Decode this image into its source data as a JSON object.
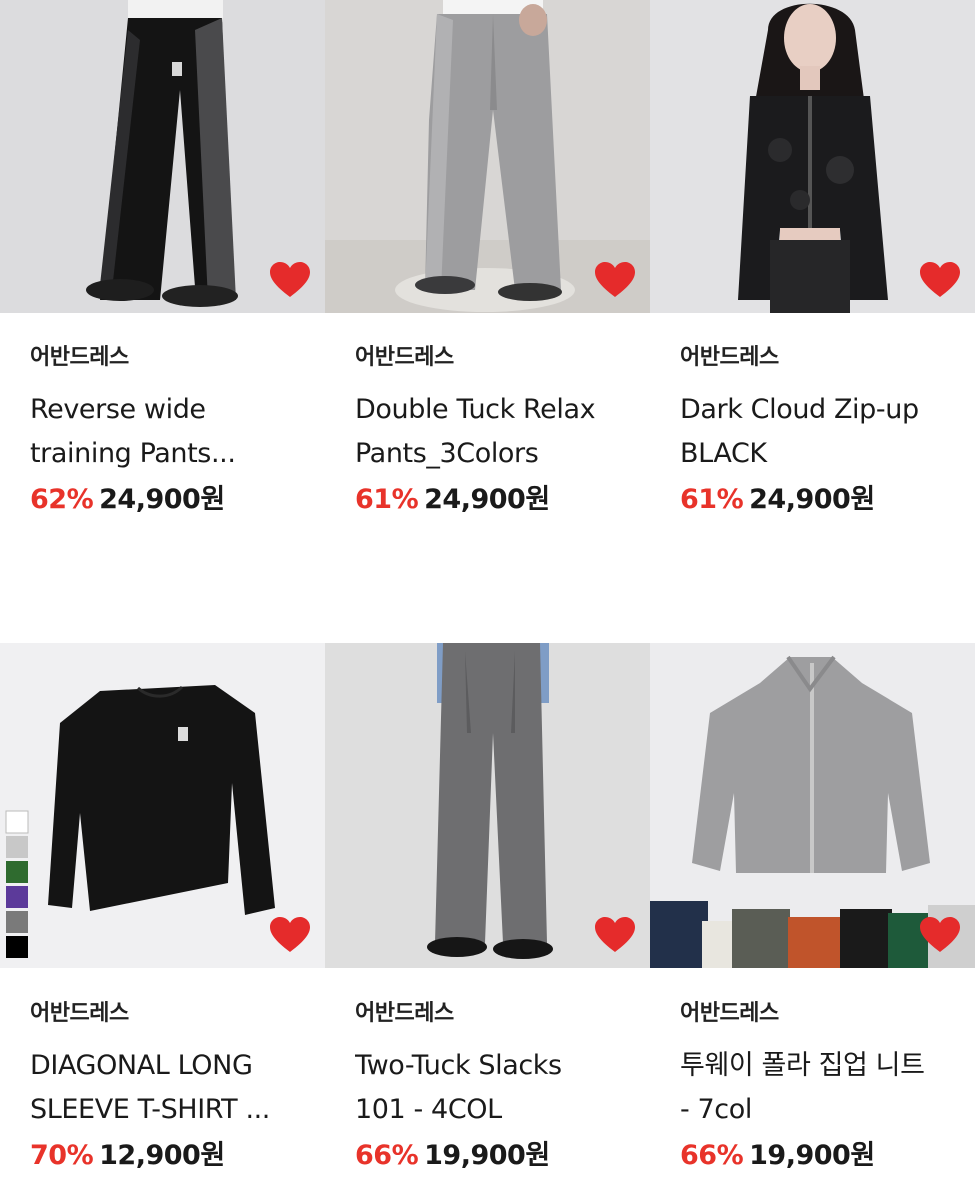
{
  "colors": {
    "discount": "#e8332a",
    "heart": "#e52b2b"
  },
  "products": [
    {
      "brand": "어반드레스",
      "name_line1": "Reverse wide",
      "name_line2": "training Pants...",
      "discount": "62%",
      "price": "24,900원",
      "icon": "heart-icon"
    },
    {
      "brand": "어반드레스",
      "name_line1": "Double Tuck Relax",
      "name_line2": "Pants_3Colors",
      "discount": "61%",
      "price": "24,900원",
      "icon": "heart-icon"
    },
    {
      "brand": "어반드레스",
      "name_line1": "Dark Cloud Zip-up",
      "name_line2": "BLACK",
      "discount": "61%",
      "price": "24,900원",
      "icon": "heart-icon"
    },
    {
      "brand": "어반드레스",
      "name_line1": "DIAGONAL LONG",
      "name_line2": "SLEEVE T-SHIRT ...",
      "discount": "70%",
      "price": "12,900원",
      "icon": "heart-icon"
    },
    {
      "brand": "어반드레스",
      "name_line1": "Two-Tuck Slacks",
      "name_line2": "101 - 4COL",
      "discount": "66%",
      "price": "19,900원",
      "icon": "heart-icon"
    },
    {
      "brand": "어반드레스",
      "name_line1": "투웨이 폴라 집업 니트",
      "name_line2": "- 7col",
      "discount": "66%",
      "price": "19,900원",
      "icon": "heart-icon"
    }
  ]
}
